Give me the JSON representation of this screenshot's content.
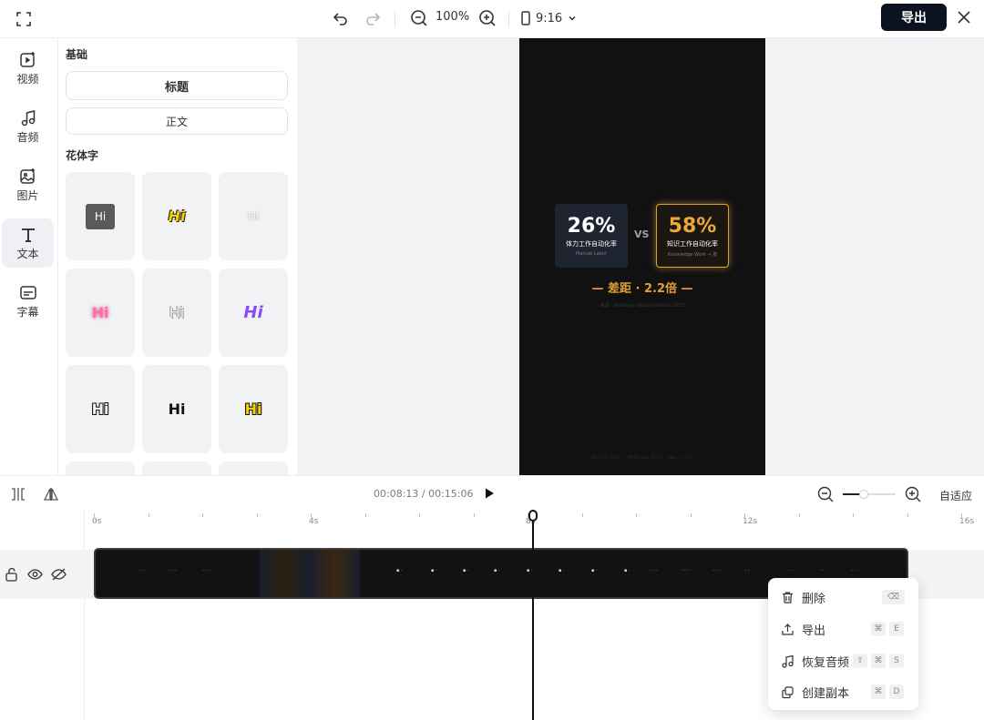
{
  "topbar": {
    "zoom": "100%",
    "aspect_ratio": "9:16",
    "export_label": "导出"
  },
  "rail": {
    "items": [
      {
        "label": "视频",
        "icon": "video-add-icon"
      },
      {
        "label": "音频",
        "icon": "music-note-icon"
      },
      {
        "label": "图片",
        "icon": "image-add-icon"
      },
      {
        "label": "文本",
        "icon": "text-icon"
      },
      {
        "label": "字幕",
        "icon": "subtitle-icon"
      }
    ],
    "active": "文本"
  },
  "panel": {
    "basic_title": "基础",
    "heading_preset": "标题",
    "body_preset": "正文",
    "fancy_title": "花体字",
    "fancy_tiles": [
      "Hi",
      "Hi",
      "Hi",
      "Hi",
      "Hi",
      "Hi",
      "Hi",
      "Hi",
      "Hi"
    ]
  },
  "video": {
    "left_pct": "26%",
    "left_label": "体力工作自动化率",
    "left_sub": "Manual Labor",
    "vs": "VS",
    "right_pct": "58%",
    "right_label": "知识工作自动化率",
    "right_sub": "Knowledge Work → 涨",
    "gap": "— 差距 · 2.2倍 —",
    "source": "来源：McKinsey Global Institute 2023",
    "footnote": "58% vs 26% — McKinsey 2023 · Gap ≈ 2.2×"
  },
  "timeline": {
    "current_time": "00:08:13",
    "total_time": "00:15:06",
    "time_display": "00:08:13 / 00:15:06",
    "fit_label": "自适应",
    "zoom_level": 0.4,
    "ruler_labels": [
      "0s",
      "4s",
      "8s",
      "12s",
      "16s"
    ]
  },
  "context_menu": {
    "items": [
      {
        "label": "删除",
        "icon": "trash-icon",
        "keys": [
          "⌫"
        ]
      },
      {
        "label": "导出",
        "icon": "upload-icon",
        "keys": [
          "⌘",
          "E"
        ]
      },
      {
        "label": "恢复音频",
        "icon": "music-note-icon",
        "keys": [
          "⇧",
          "⌘",
          "S"
        ]
      },
      {
        "label": "创建副本",
        "icon": "duplicate-icon",
        "keys": [
          "⌘",
          "D"
        ]
      }
    ]
  }
}
